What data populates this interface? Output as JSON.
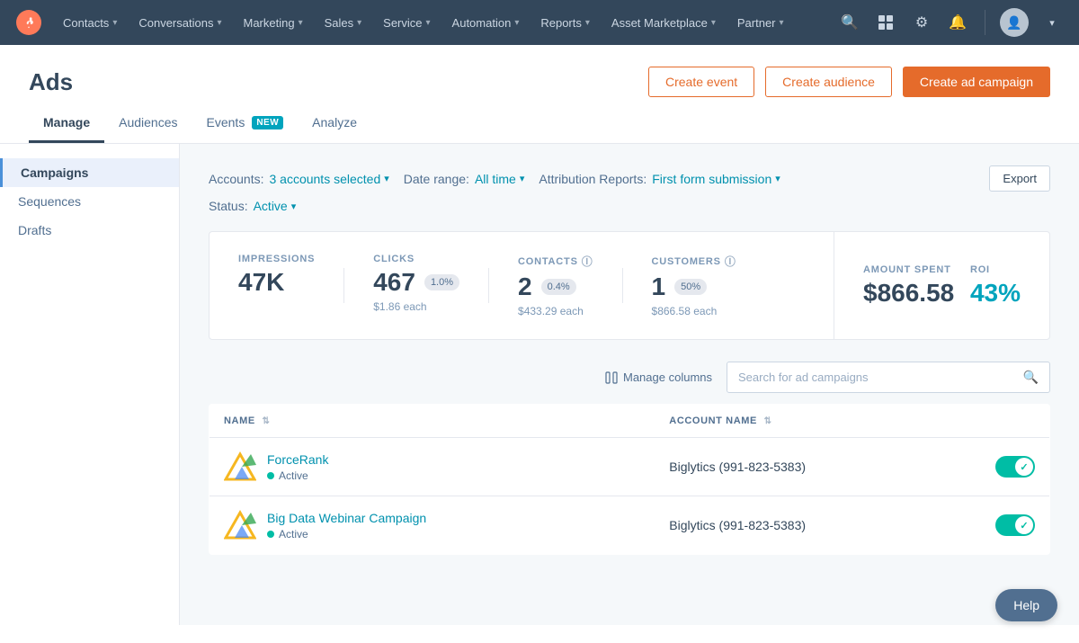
{
  "nav": {
    "items": [
      {
        "label": "Contacts",
        "id": "contacts"
      },
      {
        "label": "Conversations",
        "id": "conversations"
      },
      {
        "label": "Marketing",
        "id": "marketing"
      },
      {
        "label": "Sales",
        "id": "sales"
      },
      {
        "label": "Service",
        "id": "service"
      },
      {
        "label": "Automation",
        "id": "automation"
      },
      {
        "label": "Reports",
        "id": "reports"
      },
      {
        "label": "Asset Marketplace",
        "id": "asset-marketplace"
      },
      {
        "label": "Partner",
        "id": "partner"
      }
    ]
  },
  "page": {
    "title": "Ads"
  },
  "buttons": {
    "create_event": "Create event",
    "create_audience": "Create audience",
    "create_campaign": "Create ad campaign",
    "export": "Export",
    "manage_columns": "Manage columns"
  },
  "tabs": [
    {
      "label": "Manage",
      "id": "manage",
      "active": true,
      "badge": null
    },
    {
      "label": "Audiences",
      "id": "audiences",
      "active": false,
      "badge": null
    },
    {
      "label": "Events",
      "id": "events",
      "active": false,
      "badge": "NEW"
    },
    {
      "label": "Analyze",
      "id": "analyze",
      "active": false,
      "badge": null
    }
  ],
  "sidebar": {
    "items": [
      {
        "label": "Campaigns",
        "id": "campaigns",
        "active": true
      },
      {
        "label": "Sequences",
        "id": "sequences",
        "active": false
      },
      {
        "label": "Drafts",
        "id": "drafts",
        "active": false
      }
    ]
  },
  "filters": {
    "accounts_label": "Accounts:",
    "accounts_value": "3 accounts selected",
    "date_range_label": "Date range:",
    "date_range_value": "All time",
    "attribution_label": "Attribution Reports:",
    "attribution_value": "First form submission",
    "status_label": "Status:",
    "status_value": "Active"
  },
  "stats": {
    "impressions": {
      "label": "IMPRESSIONS",
      "value": "47K"
    },
    "clicks": {
      "label": "CLICKS",
      "value": "467",
      "badge": "1.0%",
      "sub": "$1.86 each"
    },
    "contacts": {
      "label": "CONTACTS",
      "value": "2",
      "badge": "0.4%",
      "sub": "$433.29 each"
    },
    "customers": {
      "label": "CUSTOMERS",
      "value": "1",
      "badge": "50%",
      "sub": "$866.58 each"
    },
    "amount_spent": {
      "label": "AMOUNT SPENT",
      "value": "$866.58"
    },
    "roi": {
      "label": "ROI",
      "value": "43%"
    }
  },
  "table": {
    "columns": [
      {
        "label": "NAME",
        "id": "name"
      },
      {
        "label": "ACCOUNT NAME",
        "id": "account"
      }
    ],
    "search_placeholder": "Search for ad campaigns",
    "rows": [
      {
        "id": "forcerank",
        "name": "ForceRank",
        "status": "Active",
        "account": "Biglytics (991-823-5383)",
        "toggle_on": true
      },
      {
        "id": "big-data-webinar",
        "name": "Big Data Webinar Campaign",
        "status": "Active",
        "account": "Biglytics (991-823-5383)",
        "toggle_on": true
      }
    ]
  },
  "help": {
    "label": "Help"
  }
}
